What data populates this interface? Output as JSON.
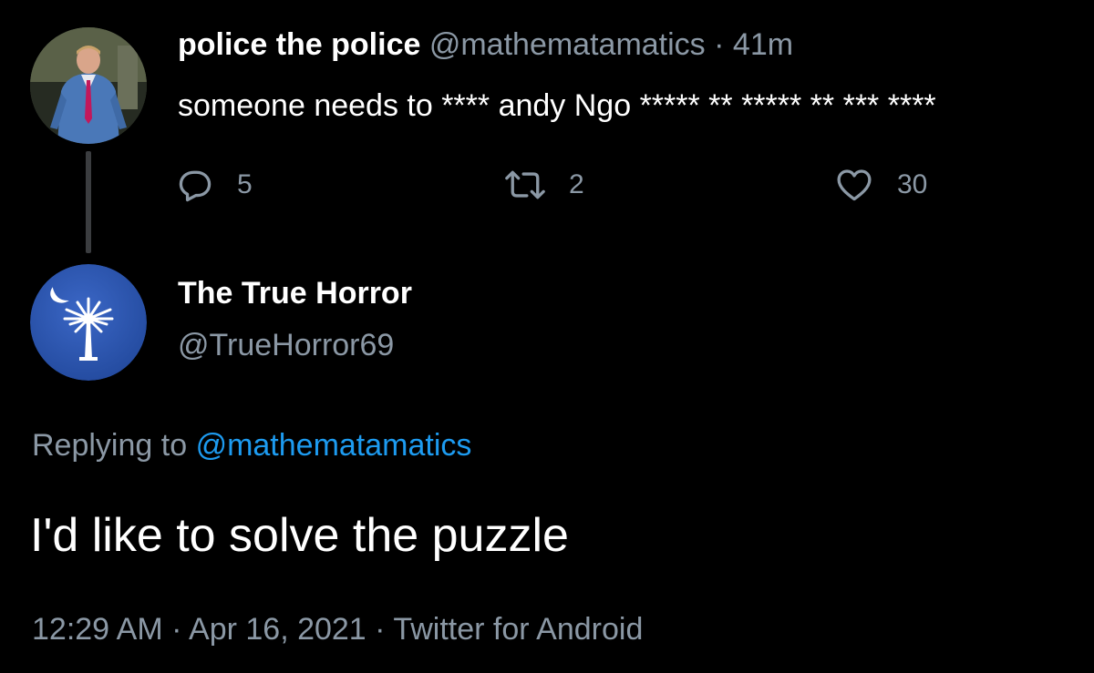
{
  "parent_tweet": {
    "display_name": "police the police",
    "handle": "@mathematamatics",
    "separator": "·",
    "time_ago": "41m",
    "text": "someone needs to **** andy Ngo ***** ** ***** ** *** ****",
    "reply_count": "5",
    "retweet_count": "2",
    "like_count": "30"
  },
  "reply_tweet": {
    "display_name": "The True Horror",
    "handle": "@TrueHorror69",
    "replying_to_label": "Replying to",
    "replying_to_handle": "@mathematamatics",
    "text": "I'd like to solve the puzzle",
    "time": "12:29 AM",
    "separator": "·",
    "date": "Apr 16, 2021",
    "source": "Twitter for Android"
  },
  "colors": {
    "background": "#000000",
    "text_primary": "#ffffff",
    "text_secondary": "#8b98a5",
    "link": "#1d9bf0",
    "thread_line": "#3b3d40",
    "flag_blue": "#2d57b4"
  },
  "icons": {
    "reply": "reply-icon",
    "retweet": "retweet-icon",
    "like": "heart-icon"
  }
}
